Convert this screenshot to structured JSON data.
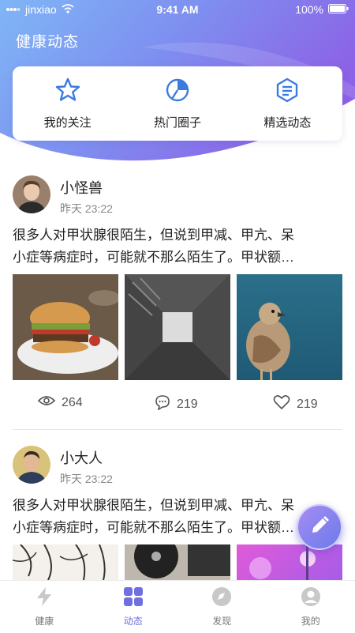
{
  "status_bar": {
    "carrier": "jinxiao",
    "time": "9:41 AM",
    "battery": "100%"
  },
  "header": {
    "title": "健康动态"
  },
  "quick_links": [
    {
      "label": "我的关注",
      "icon": "star-icon"
    },
    {
      "label": "热门圈子",
      "icon": "pie-chart-icon"
    },
    {
      "label": "精选动态",
      "icon": "hexagon-list-icon"
    }
  ],
  "posts": [
    {
      "username": "小怪兽",
      "time": "昨天 23:22",
      "text_line1": "很多人对甲状腺很陌生，但说到甲减、甲亢、呆",
      "text_line2": "小症等病症时，可能就不那么陌生了。甲状额…",
      "images": [
        "burger-photo",
        "building-photo",
        "bird-photo"
      ],
      "views": "264",
      "comments": "219",
      "likes": "219"
    },
    {
      "username": "小大人",
      "time": "昨天 23:22",
      "text_line1": "很多人对甲状腺很陌生，但说到甲减、甲亢、呆",
      "text_line2": "小症等病症时，可能就不那么陌生了。甲状额…",
      "images": [
        "sketch-photo",
        "record-player-photo",
        "purple-flower-photo"
      ]
    }
  ],
  "tab_bar": [
    {
      "label": "健康",
      "icon": "lightning-icon"
    },
    {
      "label": "动态",
      "icon": "grid-icon",
      "active": true
    },
    {
      "label": "发现",
      "icon": "compass-icon"
    },
    {
      "label": "我的",
      "icon": "user-icon"
    }
  ],
  "colors": {
    "accent": "#6f6fe0",
    "header_start": "#7fb0f5",
    "header_end": "#8a6ce8"
  }
}
